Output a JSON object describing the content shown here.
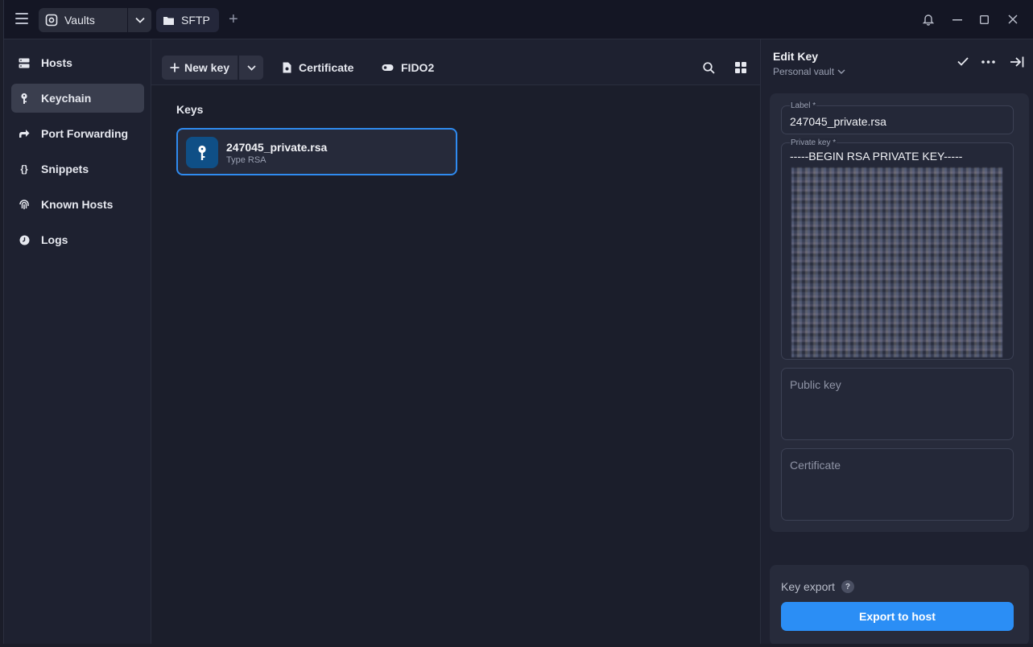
{
  "titlebar": {
    "vaults_tab": "Vaults",
    "sftp_tab": "SFTP"
  },
  "sidebar": {
    "items": [
      {
        "label": "Hosts",
        "icon": "hosts-icon"
      },
      {
        "label": "Keychain",
        "icon": "key-icon",
        "active": true
      },
      {
        "label": "Port Forwarding",
        "icon": "port-forwarding-icon"
      },
      {
        "label": "Snippets",
        "icon": "snippets-icon"
      },
      {
        "label": "Known Hosts",
        "icon": "fingerprint-icon"
      },
      {
        "label": "Logs",
        "icon": "clock-icon"
      }
    ]
  },
  "toolbar": {
    "new_key": "New key",
    "certificate": "Certificate",
    "fido2": "FIDO2"
  },
  "keys": {
    "section_title": "Keys",
    "items": [
      {
        "name": "247045_private.rsa",
        "type": "Type RSA"
      }
    ]
  },
  "panel": {
    "title": "Edit Key",
    "vault": "Personal vault",
    "label_field": {
      "label": "Label *",
      "value": "247045_private.rsa"
    },
    "private_key_field": {
      "label": "Private key *",
      "value": "-----BEGIN RSA PRIVATE KEY-----"
    },
    "public_key_field": {
      "placeholder": "Public key"
    },
    "certificate_field": {
      "placeholder": "Certificate"
    },
    "key_export_label": "Key export",
    "export_button": "Export to host"
  },
  "colors": {
    "accent": "#2b8ef5",
    "selected_border": "#2f8bf0",
    "key_icon_bg": "#0f4f86"
  }
}
